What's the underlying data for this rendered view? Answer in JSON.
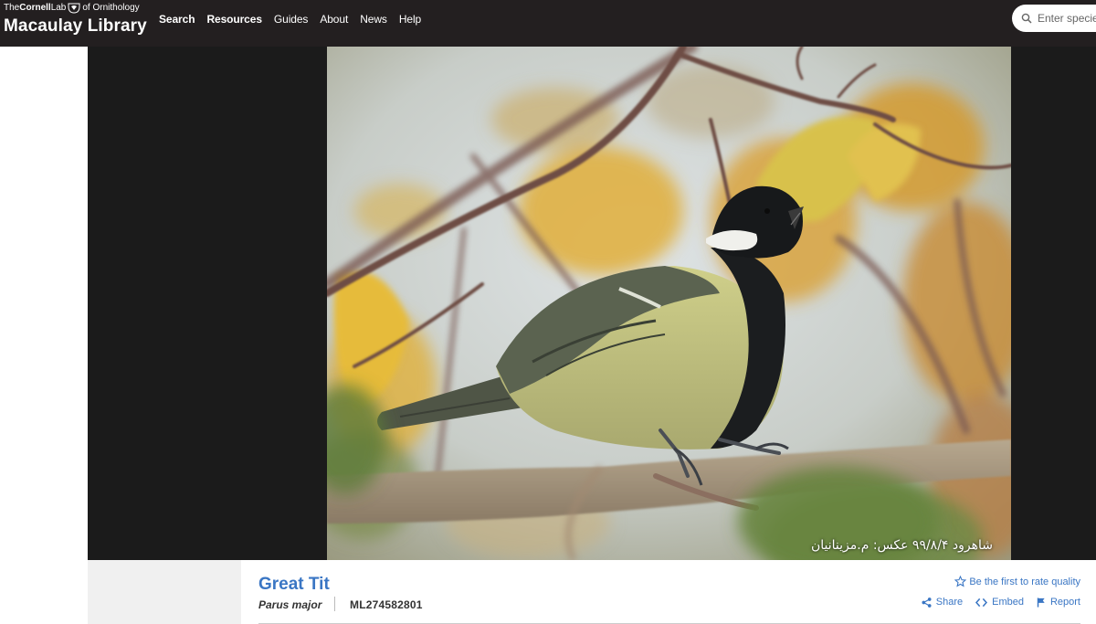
{
  "header": {
    "logo": {
      "line1_the": "The",
      "line1_cornell": "Cornell",
      "line1_lab": "Lab",
      "line1_of": "of Ornithology",
      "line2": "Macaulay Library"
    },
    "nav": [
      "Search",
      "Resources",
      "Guides",
      "About",
      "News",
      "Help"
    ],
    "search_placeholder": "Enter species"
  },
  "media": {
    "caption": "شاهرود ۹۹/۸/۴  عکس: م.مزینانیان"
  },
  "info": {
    "common_name": "Great Tit",
    "scientific_name": "Parus major",
    "catalog_id": "ML274582801",
    "rate_text": "Be the first to rate quality",
    "share": "Share",
    "embed": "Embed",
    "report": "Report"
  },
  "colors": {
    "header_bg": "#231f20",
    "viewer_bg": "#1b1b1b",
    "link_blue": "#3a76c4"
  }
}
